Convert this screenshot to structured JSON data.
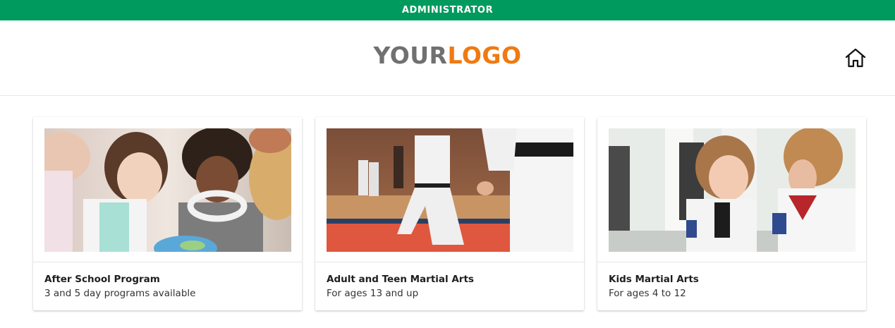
{
  "admin_bar": {
    "label": "ADMINISTRATOR",
    "color": "#009a5e"
  },
  "header": {
    "logo": {
      "part1": "YOUR",
      "part2": "LOGO",
      "color1": "#707070",
      "color2": "#ef7a12"
    },
    "home_icon": "home-icon"
  },
  "cards": [
    {
      "title": "After School Program",
      "subtitle": "3 and 5 day programs available",
      "image": "children-looking-at-globe-photo"
    },
    {
      "title": "Adult and Teen Martial Arts",
      "subtitle": "For ages 13 and up",
      "image": "karate-black-belts-in-dojo-photo"
    },
    {
      "title": "Kids Martial Arts",
      "subtitle": "For ages 4 to 12",
      "image": "kids-in-gi-practicing-photo"
    }
  ]
}
